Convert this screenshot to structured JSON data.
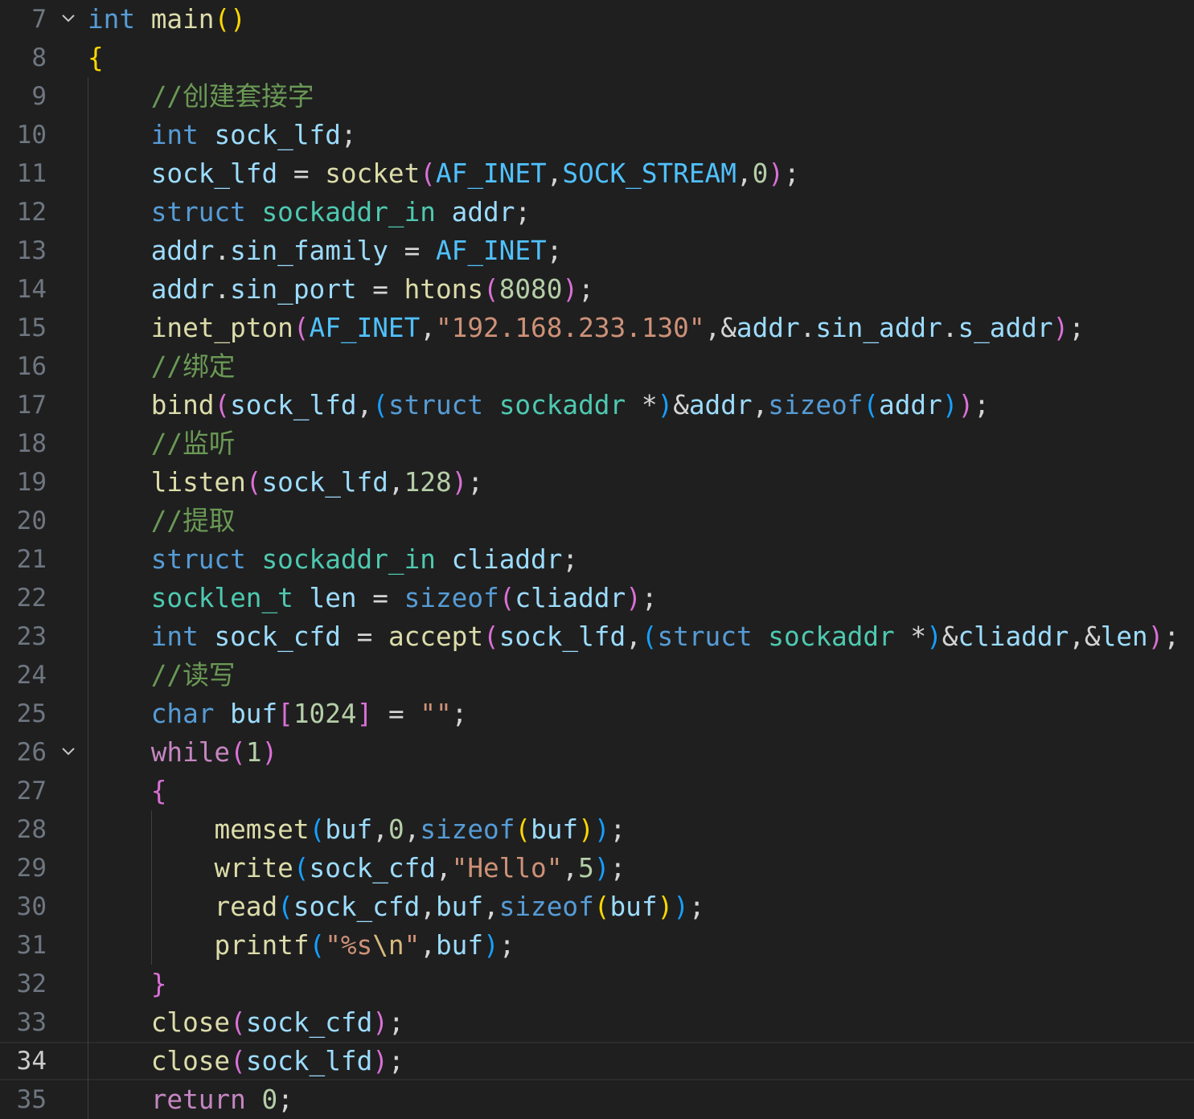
{
  "editor": {
    "lines": [
      {
        "number": "7",
        "fold": true,
        "tokens": [
          [
            "kw",
            "int"
          ],
          [
            "pun",
            " "
          ],
          [
            "fn",
            "main"
          ],
          [
            "br1",
            "()"
          ]
        ]
      },
      {
        "number": "8",
        "tokens": [
          [
            "br1",
            "{"
          ]
        ]
      },
      {
        "number": "9",
        "tokens": [
          [
            "pun",
            "    "
          ],
          [
            "cmt",
            "//创建套接字"
          ]
        ]
      },
      {
        "number": "10",
        "tokens": [
          [
            "pun",
            "    "
          ],
          [
            "kw",
            "int"
          ],
          [
            "pun",
            " "
          ],
          [
            "var",
            "sock_lfd"
          ],
          [
            "pun",
            ";"
          ]
        ]
      },
      {
        "number": "11",
        "tokens": [
          [
            "pun",
            "    "
          ],
          [
            "var",
            "sock_lfd"
          ],
          [
            "pun",
            " = "
          ],
          [
            "fn",
            "socket"
          ],
          [
            "br2",
            "("
          ],
          [
            "con",
            "AF_INET"
          ],
          [
            "pun",
            ","
          ],
          [
            "con",
            "SOCK_STREAM"
          ],
          [
            "pun",
            ","
          ],
          [
            "num",
            "0"
          ],
          [
            "br2",
            ")"
          ],
          [
            "pun",
            ";"
          ]
        ]
      },
      {
        "number": "12",
        "tokens": [
          [
            "pun",
            "    "
          ],
          [
            "kw",
            "struct"
          ],
          [
            "pun",
            " "
          ],
          [
            "type",
            "sockaddr_in"
          ],
          [
            "pun",
            " "
          ],
          [
            "var",
            "addr"
          ],
          [
            "pun",
            ";"
          ]
        ]
      },
      {
        "number": "13",
        "tokens": [
          [
            "pun",
            "    "
          ],
          [
            "var",
            "addr"
          ],
          [
            "pun",
            "."
          ],
          [
            "var",
            "sin_family"
          ],
          [
            "pun",
            " = "
          ],
          [
            "con",
            "AF_INET"
          ],
          [
            "pun",
            ";"
          ]
        ]
      },
      {
        "number": "14",
        "tokens": [
          [
            "pun",
            "    "
          ],
          [
            "var",
            "addr"
          ],
          [
            "pun",
            "."
          ],
          [
            "var",
            "sin_port"
          ],
          [
            "pun",
            " = "
          ],
          [
            "fn",
            "htons"
          ],
          [
            "br2",
            "("
          ],
          [
            "num",
            "8080"
          ],
          [
            "br2",
            ")"
          ],
          [
            "pun",
            ";"
          ]
        ]
      },
      {
        "number": "15",
        "tokens": [
          [
            "pun",
            "    "
          ],
          [
            "fn",
            "inet_pton"
          ],
          [
            "br2",
            "("
          ],
          [
            "con",
            "AF_INET"
          ],
          [
            "pun",
            ","
          ],
          [
            "str",
            "\"192.168.233.130\""
          ],
          [
            "pun",
            ",&"
          ],
          [
            "var",
            "addr"
          ],
          [
            "pun",
            "."
          ],
          [
            "var",
            "sin_addr"
          ],
          [
            "pun",
            "."
          ],
          [
            "var",
            "s_addr"
          ],
          [
            "br2",
            ")"
          ],
          [
            "pun",
            ";"
          ]
        ]
      },
      {
        "number": "16",
        "tokens": [
          [
            "pun",
            "    "
          ],
          [
            "cmt",
            "//绑定"
          ]
        ]
      },
      {
        "number": "17",
        "tokens": [
          [
            "pun",
            "    "
          ],
          [
            "fn",
            "bind"
          ],
          [
            "br2",
            "("
          ],
          [
            "var",
            "sock_lfd"
          ],
          [
            "pun",
            ","
          ],
          [
            "br3",
            "("
          ],
          [
            "kw",
            "struct"
          ],
          [
            "pun",
            " "
          ],
          [
            "type",
            "sockaddr"
          ],
          [
            "pun",
            " *"
          ],
          [
            "br3",
            ")"
          ],
          [
            "pun",
            "&"
          ],
          [
            "var",
            "addr"
          ],
          [
            "pun",
            ","
          ],
          [
            "kw",
            "sizeof"
          ],
          [
            "br3",
            "("
          ],
          [
            "var",
            "addr"
          ],
          [
            "br3",
            ")"
          ],
          [
            "br2",
            ")"
          ],
          [
            "pun",
            ";"
          ]
        ]
      },
      {
        "number": "18",
        "tokens": [
          [
            "pun",
            "    "
          ],
          [
            "cmt",
            "//监听"
          ]
        ]
      },
      {
        "number": "19",
        "tokens": [
          [
            "pun",
            "    "
          ],
          [
            "fn",
            "listen"
          ],
          [
            "br2",
            "("
          ],
          [
            "var",
            "sock_lfd"
          ],
          [
            "pun",
            ","
          ],
          [
            "num",
            "128"
          ],
          [
            "br2",
            ")"
          ],
          [
            "pun",
            ";"
          ]
        ]
      },
      {
        "number": "20",
        "tokens": [
          [
            "pun",
            "    "
          ],
          [
            "cmt",
            "//提取"
          ]
        ]
      },
      {
        "number": "21",
        "tokens": [
          [
            "pun",
            "    "
          ],
          [
            "kw",
            "struct"
          ],
          [
            "pun",
            " "
          ],
          [
            "type",
            "sockaddr_in"
          ],
          [
            "pun",
            " "
          ],
          [
            "var",
            "cliaddr"
          ],
          [
            "pun",
            ";"
          ]
        ]
      },
      {
        "number": "22",
        "tokens": [
          [
            "pun",
            "    "
          ],
          [
            "type",
            "socklen_t"
          ],
          [
            "pun",
            " "
          ],
          [
            "var",
            "len"
          ],
          [
            "pun",
            " = "
          ],
          [
            "kw",
            "sizeof"
          ],
          [
            "br2",
            "("
          ],
          [
            "var",
            "cliaddr"
          ],
          [
            "br2",
            ")"
          ],
          [
            "pun",
            ";"
          ]
        ]
      },
      {
        "number": "23",
        "tokens": [
          [
            "pun",
            "    "
          ],
          [
            "kw",
            "int"
          ],
          [
            "pun",
            " "
          ],
          [
            "var",
            "sock_cfd"
          ],
          [
            "pun",
            " = "
          ],
          [
            "fn",
            "accept"
          ],
          [
            "br2",
            "("
          ],
          [
            "var",
            "sock_lfd"
          ],
          [
            "pun",
            ","
          ],
          [
            "br3",
            "("
          ],
          [
            "kw",
            "struct"
          ],
          [
            "pun",
            " "
          ],
          [
            "type",
            "sockaddr"
          ],
          [
            "pun",
            " *"
          ],
          [
            "br3",
            ")"
          ],
          [
            "pun",
            "&"
          ],
          [
            "var",
            "cliaddr"
          ],
          [
            "pun",
            ",&"
          ],
          [
            "var",
            "len"
          ],
          [
            "br2",
            ")"
          ],
          [
            "pun",
            ";"
          ]
        ]
      },
      {
        "number": "24",
        "tokens": [
          [
            "pun",
            "    "
          ],
          [
            "cmt",
            "//读写"
          ]
        ]
      },
      {
        "number": "25",
        "tokens": [
          [
            "pun",
            "    "
          ],
          [
            "kw",
            "char"
          ],
          [
            "pun",
            " "
          ],
          [
            "var",
            "buf"
          ],
          [
            "br2",
            "["
          ],
          [
            "num",
            "1024"
          ],
          [
            "br2",
            "]"
          ],
          [
            "pun",
            " = "
          ],
          [
            "str",
            "\"\""
          ],
          [
            "pun",
            ";"
          ]
        ]
      },
      {
        "number": "26",
        "fold": true,
        "tokens": [
          [
            "pun",
            "    "
          ],
          [
            "ctl",
            "while"
          ],
          [
            "br2",
            "("
          ],
          [
            "num",
            "1"
          ],
          [
            "br2",
            ")"
          ]
        ]
      },
      {
        "number": "27",
        "tokens": [
          [
            "pun",
            "    "
          ],
          [
            "br2",
            "{"
          ]
        ]
      },
      {
        "number": "28",
        "tokens": [
          [
            "pun",
            "        "
          ],
          [
            "fn",
            "memset"
          ],
          [
            "br3",
            "("
          ],
          [
            "var",
            "buf"
          ],
          [
            "pun",
            ","
          ],
          [
            "num",
            "0"
          ],
          [
            "pun",
            ","
          ],
          [
            "kw",
            "sizeof"
          ],
          [
            "br1",
            "("
          ],
          [
            "var",
            "buf"
          ],
          [
            "br1",
            ")"
          ],
          [
            "br3",
            ")"
          ],
          [
            "pun",
            ";"
          ]
        ]
      },
      {
        "number": "29",
        "tokens": [
          [
            "pun",
            "        "
          ],
          [
            "fn",
            "write"
          ],
          [
            "br3",
            "("
          ],
          [
            "var",
            "sock_cfd"
          ],
          [
            "pun",
            ","
          ],
          [
            "str",
            "\"Hello\""
          ],
          [
            "pun",
            ","
          ],
          [
            "num",
            "5"
          ],
          [
            "br3",
            ")"
          ],
          [
            "pun",
            ";"
          ]
        ]
      },
      {
        "number": "30",
        "tokens": [
          [
            "pun",
            "        "
          ],
          [
            "fn",
            "read"
          ],
          [
            "br3",
            "("
          ],
          [
            "var",
            "sock_cfd"
          ],
          [
            "pun",
            ","
          ],
          [
            "var",
            "buf"
          ],
          [
            "pun",
            ","
          ],
          [
            "kw",
            "sizeof"
          ],
          [
            "br1",
            "("
          ],
          [
            "var",
            "buf"
          ],
          [
            "br1",
            ")"
          ],
          [
            "br3",
            ")"
          ],
          [
            "pun",
            ";"
          ]
        ]
      },
      {
        "number": "31",
        "tokens": [
          [
            "pun",
            "        "
          ],
          [
            "fn",
            "printf"
          ],
          [
            "br3",
            "("
          ],
          [
            "str",
            "\"%s"
          ],
          [
            "esc",
            "\\n"
          ],
          [
            "str",
            "\""
          ],
          [
            "pun",
            ","
          ],
          [
            "var",
            "buf"
          ],
          [
            "br3",
            ")"
          ],
          [
            "pun",
            ";"
          ]
        ]
      },
      {
        "number": "32",
        "tokens": [
          [
            "pun",
            "    "
          ],
          [
            "br2",
            "}"
          ]
        ]
      },
      {
        "number": "33",
        "tokens": [
          [
            "pun",
            "    "
          ],
          [
            "fn",
            "close"
          ],
          [
            "br2",
            "("
          ],
          [
            "var",
            "sock_cfd"
          ],
          [
            "br2",
            ")"
          ],
          [
            "pun",
            ";"
          ]
        ]
      },
      {
        "number": "34",
        "current": true,
        "tokens": [
          [
            "pun",
            "    "
          ],
          [
            "fn",
            "close"
          ],
          [
            "br2",
            "("
          ],
          [
            "var",
            "sock_lfd"
          ],
          [
            "br2",
            ")"
          ],
          [
            "pun",
            ";"
          ]
        ]
      },
      {
        "number": "35",
        "tokens": [
          [
            "pun",
            "    "
          ],
          [
            "ctl",
            "return"
          ],
          [
            "pun",
            " "
          ],
          [
            "num",
            "0"
          ],
          [
            "pun",
            ";"
          ]
        ]
      }
    ]
  }
}
